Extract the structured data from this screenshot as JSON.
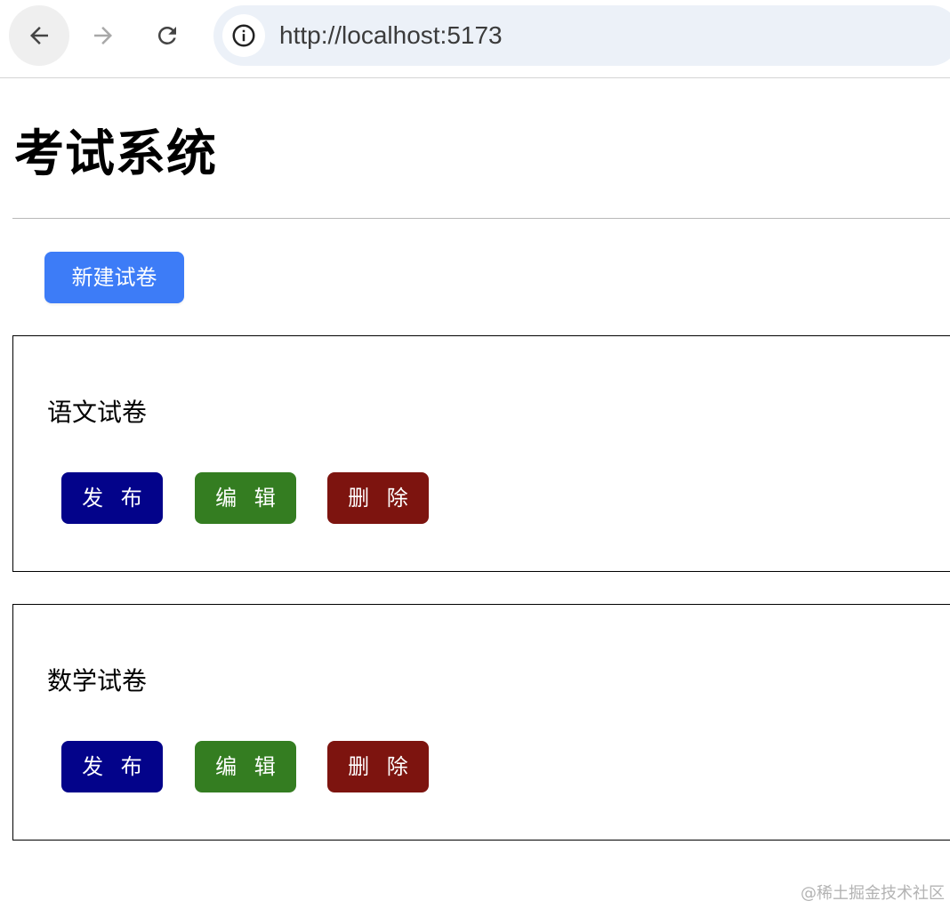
{
  "browser": {
    "url": "http://localhost:5173",
    "icons": {
      "back": "back-arrow-icon",
      "forward": "forward-arrow-icon",
      "reload": "reload-icon",
      "info": "info-icon"
    }
  },
  "page": {
    "title": "考试系统",
    "new_button_label": "新建试卷"
  },
  "papers": [
    {
      "title": "语文试卷",
      "actions": {
        "publish": "发 布",
        "edit": "编 辑",
        "delete": "删 除"
      }
    },
    {
      "title": "数学试卷",
      "actions": {
        "publish": "发 布",
        "edit": "编 辑",
        "delete": "删 除"
      }
    }
  ],
  "colors": {
    "primary": "#3d7cf7",
    "publish": "#03038a",
    "edit": "#347d21",
    "delete": "#7d140f"
  },
  "watermark": "@稀土掘金技术社区"
}
